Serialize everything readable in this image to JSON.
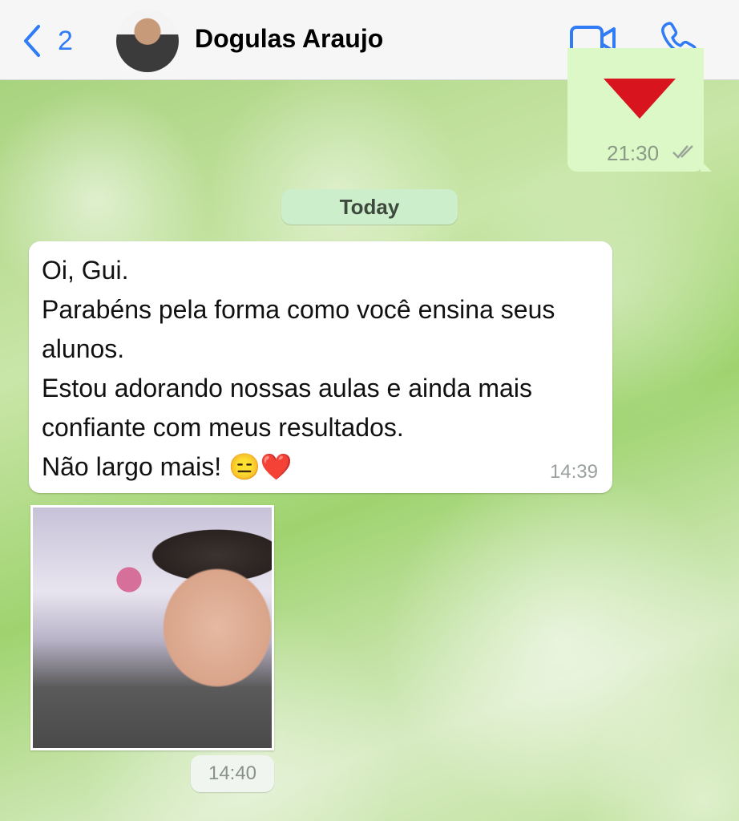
{
  "header": {
    "back_count": "2",
    "contact_name": "Dogulas Araujo",
    "icons": {
      "back": "chevron-left-icon",
      "video": "video-camera-icon",
      "call": "phone-icon"
    },
    "accent_color": "#2f7cf6"
  },
  "messages": {
    "outgoing_previous": {
      "emoji": "❤️",
      "time": "21:30",
      "status": "read-double-check"
    },
    "day_separator": "Today",
    "incoming_text": {
      "text": "Oi, Gui.\nParabéns pela forma como você ensina seus alunos.\nEstou adorando nossas aulas e ainda mais confiante com meus resultados.\nNão largo mais! 😑❤️",
      "time": "14:39"
    },
    "incoming_photo": {
      "time": "14:40"
    }
  },
  "colors": {
    "outgoing_bubble": "#dcf8c6",
    "incoming_bubble": "#ffffff",
    "header_bg": "#f6f6f6"
  }
}
